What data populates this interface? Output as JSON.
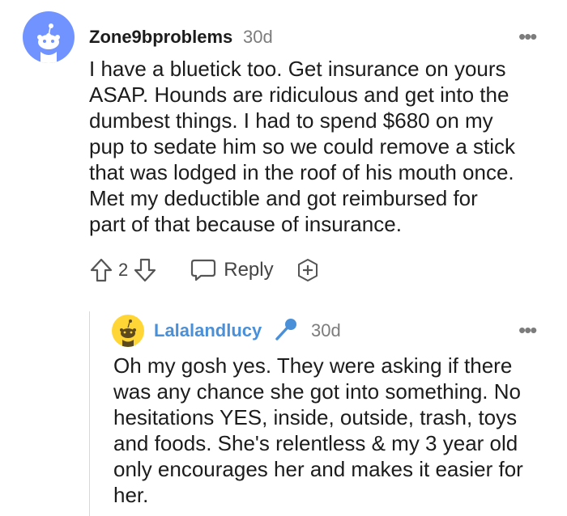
{
  "comment": {
    "username": "Zone9bproblems",
    "timestamp": "30d",
    "avatar_icon": "reddit-snoo-avatar-icon",
    "avatar_color": "#7193ff",
    "more_label": "•••",
    "lines": [
      "I have a bluetick too. Get insurance on yours",
      "ASAP. Hounds are ridiculous and get into the",
      "dumbest things. I had to spend $680 on my",
      "pup to sedate him so we could remove a stick",
      "that was lodged in the roof of his mouth once.",
      "Met my deductible and got reimbursed for",
      "part of that because of insurance."
    ],
    "vote_count": "2",
    "reply_label": "Reply",
    "upvote_icon": "arrow-up-icon",
    "downvote_icon": "arrow-down-icon",
    "reply_icon": "speech-bubble-icon",
    "award_icon": "add-award-icon"
  },
  "reply": {
    "username": "Lalalandlucy",
    "username_color": "#4a90d9",
    "timestamp": "30d",
    "avatar_icon": "reddit-snoo-avatar-icon",
    "avatar_color": "#ffd635",
    "badge_icon": "microphone-icon",
    "badge_color": "#4a90d9",
    "more_label": "•••",
    "lines": [
      "Oh my gosh yes. They were asking if there",
      "was any chance she got into something. No",
      "hesitations YES, inside, outside, trash, toys",
      "and foods. She's relentless & my 3 year old",
      "only encourages her and makes it easier for",
      "her."
    ]
  }
}
